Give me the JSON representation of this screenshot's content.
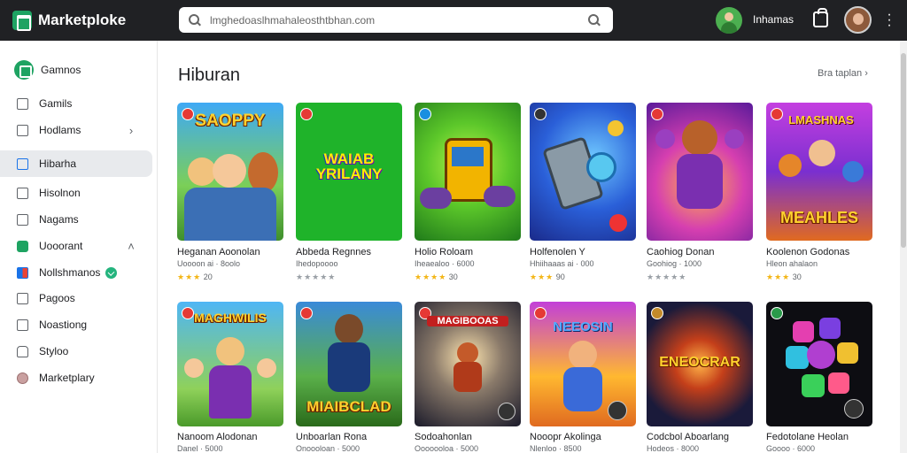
{
  "app": {
    "name": "Marketploke"
  },
  "search": {
    "value": "lmghedoaslhmahaleosthtbhan.com"
  },
  "user": {
    "name": "Inhamas"
  },
  "sidebar": {
    "header": "Gamnos",
    "items": [
      {
        "label": "Gamils"
      },
      {
        "label": "Hodlams",
        "chevron": "›"
      },
      {
        "label": "Hibarha"
      },
      {
        "label": "Hisolnon"
      },
      {
        "label": "Nagams"
      },
      {
        "label": "Uooorant",
        "chevron": "˄"
      },
      {
        "label": "Nollshmanos"
      },
      {
        "label": "Pagoos"
      },
      {
        "label": "Noastiong"
      },
      {
        "label": "Styloo"
      },
      {
        "label": "Marketplary"
      }
    ]
  },
  "main": {
    "section_title": "Hiburan",
    "see_all": "Bra taplan ›",
    "row1": [
      {
        "art_text": "SAOPPY",
        "name": "Heganan Aoonolan",
        "sub": "Uoooon ai · 8oolo",
        "stars": "★★★",
        "rating": "20"
      },
      {
        "art_text": "WAIAB YRILANY",
        "name": "Abbeda Regnnes",
        "sub": "Ihedopoooo",
        "stars": "★★★★★",
        "rating": ""
      },
      {
        "art_text": "",
        "name": "Holio Roloam",
        "sub": "Iheaealoo · 6000",
        "stars": "★★★★",
        "rating": "30"
      },
      {
        "art_text": "",
        "name": "Holfenolen Y",
        "sub": "Hhiihaaas ai · 000",
        "stars": "★★★",
        "rating": "90"
      },
      {
        "art_text": "",
        "name": "Caohiog Donan",
        "sub": "Goohiog · 1000",
        "stars": "★★★★★",
        "rating": ""
      },
      {
        "art_text": "MEAHLES",
        "name": "Koolenon Godonas",
        "sub": "Hleon ahalaon",
        "stars": "★★★",
        "rating": "30"
      }
    ],
    "row2": [
      {
        "art_text": "MAGHWILIS",
        "name": "Nanoom Alodonan",
        "sub": "Danel · 5000"
      },
      {
        "art_text": "MIAIBCLAD",
        "name": "Unboarlan Rona",
        "sub": "Onoooloan · 5000"
      },
      {
        "art_text": "",
        "name": "Sodoahonlan",
        "sub": "Ooooooloa · 5000"
      },
      {
        "art_text": "NEEOSIN",
        "name": "Nooopr Akolinga",
        "sub": "Nlenloo · 8500"
      },
      {
        "art_text": "ENEOCRAR",
        "name": "Codcbol Aboarlang",
        "sub": "Hodeos · 8000"
      },
      {
        "art_text": "",
        "name": "Fedotolane Heolan",
        "sub": "Goooo · 6000"
      }
    ]
  },
  "colors": {
    "topbar": "#202124",
    "accent": "#1ea362",
    "star": "#f3b617"
  }
}
